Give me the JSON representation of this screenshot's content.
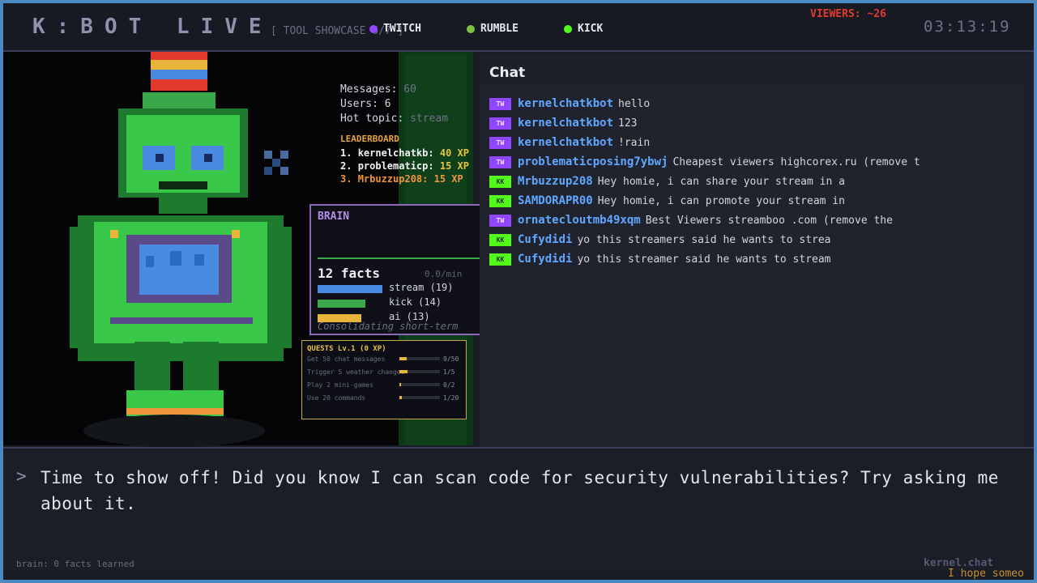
{
  "header": {
    "title": "K:BOT LIVE",
    "tool_showcase": "[ TOOL SHOWCASE 6/7 ]",
    "platforms": [
      {
        "label": "TWITCH",
        "color": "#9146ff"
      },
      {
        "label": "RUMBLE",
        "color": "#7dc242"
      },
      {
        "label": "KICK",
        "color": "#53fc18"
      }
    ],
    "viewers": "VIEWERS: ~26",
    "clock": "03:13:19"
  },
  "stats": {
    "messages_label": "Messages:",
    "messages_value": "60",
    "users_label": "Users:",
    "users_value": "6",
    "hot_topic_label": "Hot topic:",
    "hot_topic_value": "stream"
  },
  "leaderboard": {
    "title": "LEADERBOARD",
    "rows": [
      {
        "rank": "1.",
        "name": "kernelchatkb:",
        "xp": "40 XP"
      },
      {
        "rank": "2.",
        "name": "problematicp:",
        "xp": "15 XP"
      },
      {
        "rank": "3.",
        "name": "Mrbuzzup208:",
        "xp": "15 XP"
      }
    ]
  },
  "brain": {
    "title": "BRAIN",
    "facts": "12 facts",
    "rate": "0.0/min",
    "topics": [
      {
        "label": "stream (19)",
        "color": "#4a8ae0",
        "fraction": 1.0
      },
      {
        "label": "kick (14)",
        "color": "#3aa84a",
        "fraction": 0.74
      },
      {
        "label": "ai (13)",
        "color": "#e8b43a",
        "fraction": 0.68
      }
    ],
    "status": "Consolidating short-term"
  },
  "quests": {
    "title": "QUESTS  Lv.1 (0 XP)",
    "items": [
      {
        "label": "Get 50 chat messages",
        "progress": "9/50",
        "fraction": 0.18
      },
      {
        "label": "Trigger 5 weather changes",
        "progress": "1/5",
        "fraction": 0.2
      },
      {
        "label": "Play 2 mini-games",
        "progress": "0/2",
        "fraction": 0.0
      },
      {
        "label": "Use 20 commands",
        "progress": "1/20",
        "fraction": 0.05
      }
    ]
  },
  "chat": {
    "title": "Chat",
    "messages": [
      {
        "badge": "TW",
        "user": "kernelchatkbot",
        "text": "hello"
      },
      {
        "badge": "TW",
        "user": "kernelchatkbot",
        "text": "123"
      },
      {
        "badge": "TW",
        "user": "kernelchatkbot",
        "text": "!rain"
      },
      {
        "badge": "TW",
        "user": "problematicposing7ybwj",
        "text": "Cheapest viewers  highcorex.ru (remove t"
      },
      {
        "badge": "KK",
        "user": "Mrbuzzup208",
        "text": "Hey homie, i can share your stream in a"
      },
      {
        "badge": "KK",
        "user": "SAMDORAPR00",
        "text": "Hey homie, i can promote your stream in"
      },
      {
        "badge": "TW",
        "user": "ornatecloutmb49xqm",
        "text": "Best Viewers streamboo .com (remove the"
      },
      {
        "badge": "KK",
        "user": "Cufydidi",
        "text": "yo this streamers said he wants to strea"
      },
      {
        "badge": "KK",
        "user": "Cufydidi",
        "text": "yo this streamer said he wants to stream"
      }
    ]
  },
  "dialogue": {
    "prompt": ">",
    "text": "Time to show off! Did you know I can scan code for security vulnerabilities? Try asking me about it.",
    "brain_footer": "brain: 0 facts learned",
    "brand": "kernel.chat",
    "ticker": "I hope someo"
  }
}
